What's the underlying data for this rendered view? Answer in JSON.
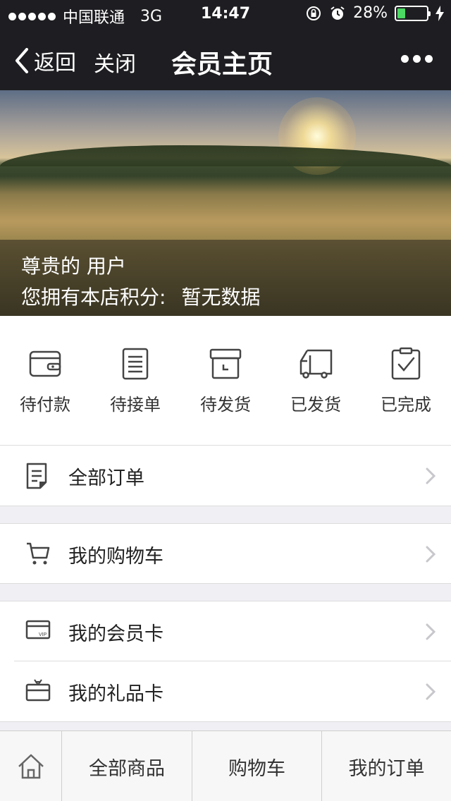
{
  "status_bar": {
    "carrier": "中国联通",
    "network": "3G",
    "time": "14:47",
    "battery": "28%",
    "battery_level": 0.28
  },
  "nav": {
    "back_label": "返回",
    "close_label": "关闭",
    "title": "会员主页",
    "more_icon": "ellipsis-icon"
  },
  "banner": {
    "user_name": "尊贵的 用户",
    "points_label": "您拥有本店积分:",
    "points_value": "暂无数据"
  },
  "order_status": [
    {
      "label": "待付款",
      "icon": "wallet-icon"
    },
    {
      "label": "待接单",
      "icon": "list-icon"
    },
    {
      "label": "待发货",
      "icon": "box-icon"
    },
    {
      "label": "已发货",
      "icon": "truck-icon"
    },
    {
      "label": "已完成",
      "icon": "clipboard-check-icon"
    }
  ],
  "menu": {
    "all_orders": "全部订单",
    "cart": "我的购物车",
    "member_card": "我的会员卡",
    "gift_card": "我的礼品卡",
    "vip_text": "VIP"
  },
  "tabbar": {
    "home_icon": "home-icon",
    "all_products": "全部商品",
    "cart": "购物车",
    "my_orders": "我的订单"
  },
  "colors": {
    "nav_bg": "#1e1e22",
    "battery_fill": "#4cd964",
    "page_bg": "#efeff4"
  }
}
